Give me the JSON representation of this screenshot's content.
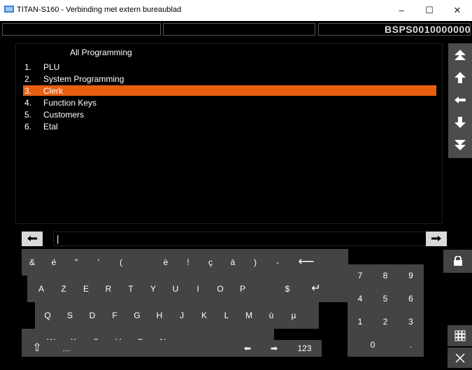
{
  "window": {
    "title": "TITAN-S160 - Verbinding met extern bureaublad",
    "minimize": "–",
    "maximize": "☐",
    "close": "✕"
  },
  "status": {
    "code": "BSPS0010000000"
  },
  "menu": {
    "title": "All Programming",
    "items": [
      {
        "num": "1.",
        "label": "PLU"
      },
      {
        "num": "2.",
        "label": "System Programming"
      },
      {
        "num": "3.",
        "label": "Clerk",
        "selected": true
      },
      {
        "num": "4.",
        "label": "Function Keys"
      },
      {
        "num": "5.",
        "label": "Customers"
      },
      {
        "num": "6.",
        "label": "Etal"
      }
    ]
  },
  "nav_icons": [
    "double-up-arrow-icon",
    "up-arrow-icon",
    "left-arrow-icon",
    "down-arrow-icon",
    "double-down-arrow-icon"
  ],
  "input": {
    "value": "|"
  },
  "keyboard": {
    "row1": [
      "&",
      "é",
      "\"",
      "'",
      "(",
      "",
      "è",
      "!",
      "ç",
      "à",
      ")",
      "-",
      "⟵"
    ],
    "row2": [
      "A",
      "Z",
      "E",
      "R",
      "T",
      "Y",
      "U",
      "I",
      "O",
      "P",
      "",
      "$",
      "↵"
    ],
    "row3": [
      "Q",
      "S",
      "D",
      "F",
      "G",
      "H",
      "J",
      "K",
      "L",
      "M",
      "ù",
      "µ"
    ],
    "row4": [
      "<",
      "W",
      "X",
      "C",
      "V",
      "B",
      "N",
      ",",
      ";",
      ":",
      "="
    ],
    "row5": [
      "⇧",
      "…",
      "",
      "⬅",
      "➡",
      "123"
    ]
  },
  "keypad": [
    "7",
    "8",
    "9",
    "4",
    "5",
    "6",
    "1",
    "2",
    "3",
    "0",
    "."
  ],
  "colors": {
    "selection": "#e8600f",
    "key_bg": "#444444",
    "nav_bg": "#4c4c4c"
  }
}
